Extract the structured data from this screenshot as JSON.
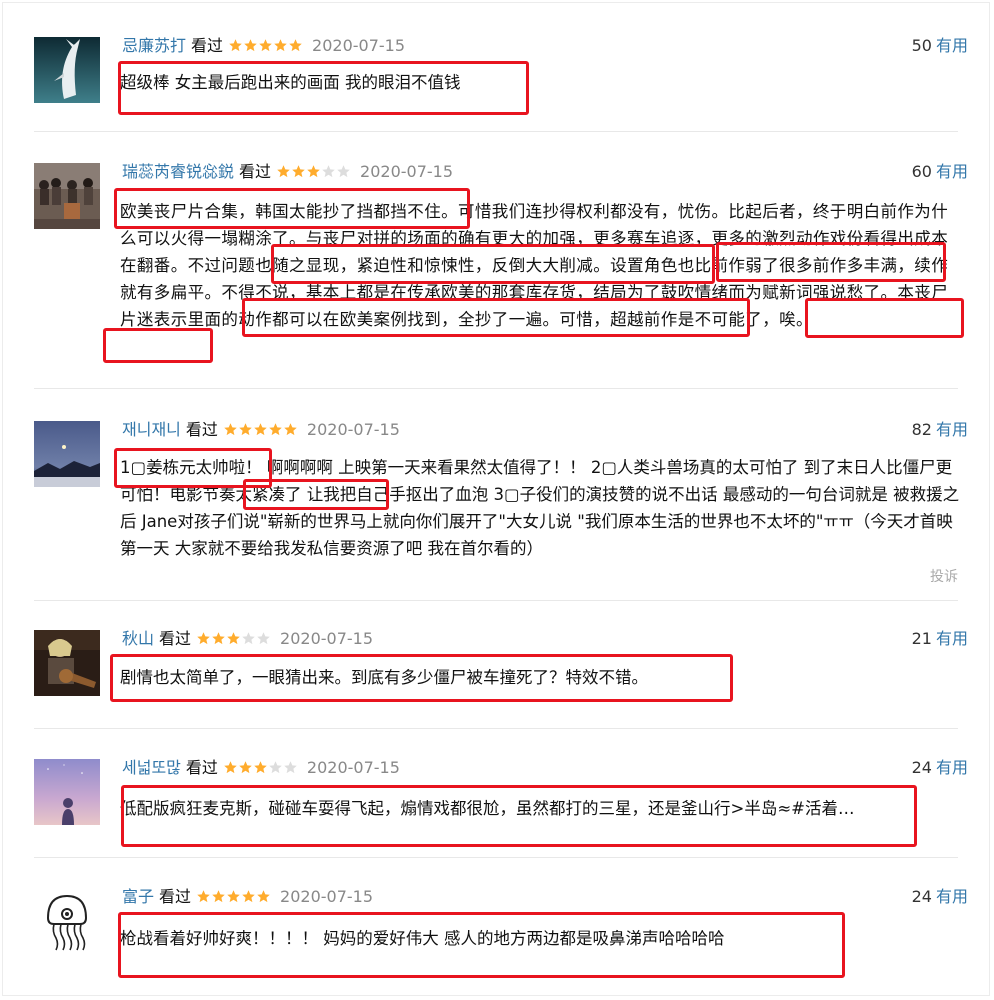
{
  "reviews": [
    {
      "author": "忌廉苏打",
      "status": "看过",
      "rating": 5,
      "date": "2020-07-15",
      "votes": "50",
      "vote_label": "有用",
      "text": "超级棒 女主最后跑出来的画面 我的眼泪不值钱",
      "avatar_icon": "whale-avatar-icon"
    },
    {
      "author": "瑞蕊芮睿锐惢鋭",
      "status": "看过",
      "rating": 3,
      "date": "2020-07-15",
      "votes": "60",
      "vote_label": "有用",
      "text": "欧美丧尸片合集，韩国太能抄了挡都挡不住。可惜我们连抄得权利都没有，忧伤。比起后者，终于明白前作为什么可以火得一塌糊涂了。与丧尸对拼的场面的确有更大的加强，更多赛车追逐，更多的激烈动作戏份看得出成本在翻番。不过问题也随之显现，紧迫性和惊悚性，反倒大大削减。设置角色也比前作弱了很多前作多丰满，续作就有多扁平。不得不说，基本上都是在传承欧美的那套库存货，结局为了鼓吹情绪而为赋新词强说愁了。本丧尸片迷表示里面的动作都可以在欧美案例找到，全抄了一遍。可惜，超越前作是不可能了，唉。",
      "avatar_icon": "crowd-photo-avatar-icon"
    },
    {
      "author": "재니재니",
      "status": "看过",
      "rating": 5,
      "date": "2020-07-15",
      "votes": "82",
      "vote_label": "有用",
      "text": "1▢姜栋元太帅啦！    啊啊啊啊 上映第一天来看果然太值得了！！ 2▢人类斗兽场真的太可怕了 到了末日人比僵尸更可怕！电影节奏太紧凑了 让我把自己手抠出了血泡 3▢子役们的演技赞的说不出话 最感动的一句台词就是 被救援之后 Jane对孩子们说\"崭新的世界马上就向你们展开了\"大女儿说 \"我们原本生活的世界也不太坏的\"ㅠㅠ（今天才首映第一天 大家就不要给我发私信要资源了吧 我在首尔看的）",
      "report_label": "投诉",
      "avatar_icon": "night-sky-avatar-icon"
    },
    {
      "author": "秋山",
      "status": "看过",
      "rating": 3,
      "date": "2020-07-15",
      "votes": "21",
      "vote_label": "有用",
      "text": "剧情也太简单了，一眼猜出来。到底有多少僵尸被车撞死了？特效不错。",
      "avatar_icon": "guitarist-avatar-icon"
    },
    {
      "author": "세넓또많",
      "status": "看过",
      "rating": 3,
      "date": "2020-07-15",
      "votes": "24",
      "vote_label": "有用",
      "text": "低配版疯狂麦克斯，碰碰车耍得飞起，煽情戏都很尬，虽然都打的三星，还是釜山行>半岛≈#活着…",
      "avatar_icon": "dusk-silhouette-avatar-icon"
    },
    {
      "author": "富子",
      "status": "看过",
      "rating": 5,
      "date": "2020-07-15",
      "votes": "24",
      "vote_label": "有用",
      "text": "枪战看着好帅好爽！！！！ 妈妈的爱好伟大 感人的地方两边都是吸鼻涕声哈哈哈哈",
      "avatar_icon": "jellyfish-avatar-icon"
    }
  ],
  "colors": {
    "author": "#3377aa",
    "star_on": "#ffac2d",
    "star_off": "#dddddd",
    "highlight": "#e8141f",
    "date": "#888888"
  }
}
